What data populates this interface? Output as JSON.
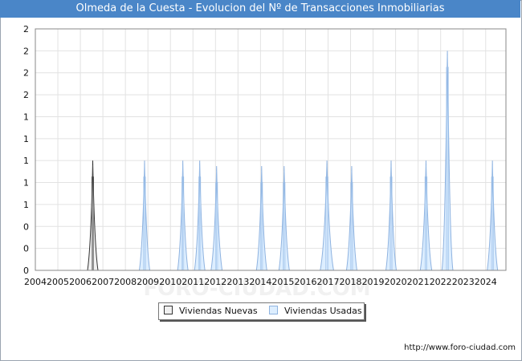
{
  "title": "Olmeda de la Cuesta - Evolucion del Nº de Transacciones Inmobiliarias",
  "footer_url": "http://www.foro-ciudad.com",
  "watermark": "FORO-CIUDAD.COM",
  "colors": {
    "title_bg": "#4a86c8",
    "nuevas_fill": "#f0f0f0",
    "nuevas_stroke": "#333333",
    "usadas_fill": "#ddeeff",
    "usadas_stroke": "#8fb3e0"
  },
  "chart_data": {
    "type": "area",
    "title": "Olmeda de la Cuesta - Evolucion del Nº de Transacciones Inmobiliarias",
    "xlabel": "",
    "ylabel": "",
    "xlim": [
      2004,
      2024.9
    ],
    "ylim": [
      0,
      2.2
    ],
    "x_tick_labels": [
      "2004",
      "2005",
      "2006",
      "2007",
      "2008",
      "2009",
      "2010",
      "2011",
      "2012",
      "2013",
      "2014",
      "2015",
      "2016",
      "2017",
      "2018",
      "2019",
      "2020",
      "2021",
      "2022",
      "2023",
      "2024"
    ],
    "y_tick_labels": [
      "0",
      "0",
      "0",
      "1",
      "1",
      "1",
      "1",
      "1",
      "2",
      "2",
      "2",
      "2"
    ],
    "grid": true,
    "legend_position": "bottom-center",
    "series": [
      {
        "name": "Viviendas Nuevas",
        "peaks": [
          {
            "x": 2006.55,
            "value": 1,
            "width": 0.25
          }
        ]
      },
      {
        "name": "Viviendas Usadas",
        "peaks": [
          {
            "x": 2008.85,
            "value": 1,
            "width": 0.25
          },
          {
            "x": 2010.55,
            "value": 1,
            "width": 0.25
          },
          {
            "x": 2011.3,
            "value": 1,
            "width": 0.25
          },
          {
            "x": 2012.05,
            "value": 0.95,
            "width": 0.28
          },
          {
            "x": 2014.05,
            "value": 0.95,
            "width": 0.25
          },
          {
            "x": 2015.05,
            "value": 0.95,
            "width": 0.25
          },
          {
            "x": 2016.95,
            "value": 1,
            "width": 0.38
          },
          {
            "x": 2018.05,
            "value": 0.95,
            "width": 0.25
          },
          {
            "x": 2019.8,
            "value": 1,
            "width": 0.25
          },
          {
            "x": 2021.35,
            "value": 1,
            "width": 0.3
          },
          {
            "x": 2022.3,
            "value": 2,
            "width": 0.28
          },
          {
            "x": 2024.3,
            "value": 1,
            "width": 0.25
          }
        ]
      }
    ]
  }
}
